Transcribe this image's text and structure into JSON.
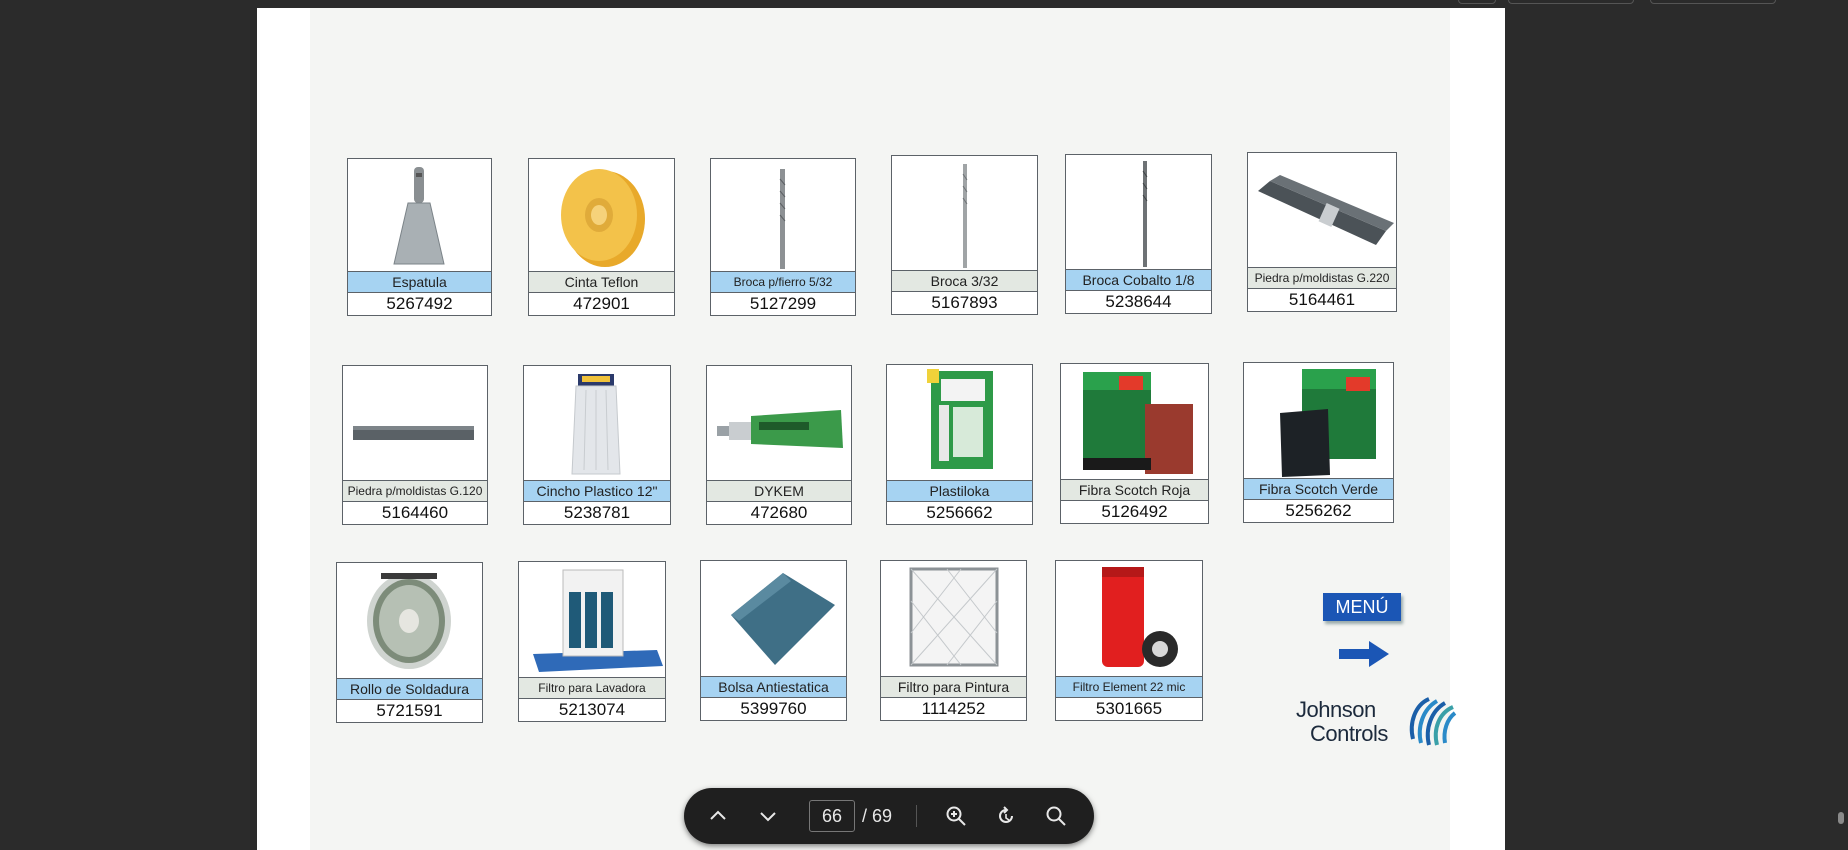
{
  "viewer": {
    "current_page": "66",
    "total_pages": "/ 69"
  },
  "products": [
    {
      "name": "Espatula",
      "code": "5267492"
    },
    {
      "name": "Cinta Teflon",
      "code": "472901"
    },
    {
      "name": "Broca p/fierro 5/32",
      "code": "5127299"
    },
    {
      "name": "Broca 3/32",
      "code": "5167893"
    },
    {
      "name": "Broca Cobalto 1/8",
      "code": "5238644"
    },
    {
      "name": "Piedra p/moldistas G.220",
      "code": "5164461"
    },
    {
      "name": "Piedra p/moldistas G.120",
      "code": "5164460"
    },
    {
      "name": "Cincho Plastico 12\"",
      "code": "5238781"
    },
    {
      "name": "DYKEM",
      "code": "472680"
    },
    {
      "name": "Plastiloka",
      "code": "5256662"
    },
    {
      "name": "Fibra Scotch Roja",
      "code": "5126492"
    },
    {
      "name": "Fibra Scotch Verde",
      "code": "5256262"
    },
    {
      "name": "Rollo de Soldadura",
      "code": "5721591"
    },
    {
      "name": "Filtro para Lavadora",
      "code": "5213074"
    },
    {
      "name": "Bolsa Antiestatica",
      "code": "5399760"
    },
    {
      "name": "Filtro para Pintura",
      "code": "1114252"
    },
    {
      "name": "Filtro Element 22 mic",
      "code": "5301665"
    }
  ],
  "menu": {
    "label": "MENÚ"
  },
  "brand": {
    "line1": "Johnson",
    "line2": "Controls"
  },
  "colors": {
    "label_blue": "#a6d3f2",
    "label_grey": "#e3e8e2",
    "menu_blue": "#1b56b5",
    "toolbar_bg": "#1f1f1f"
  }
}
